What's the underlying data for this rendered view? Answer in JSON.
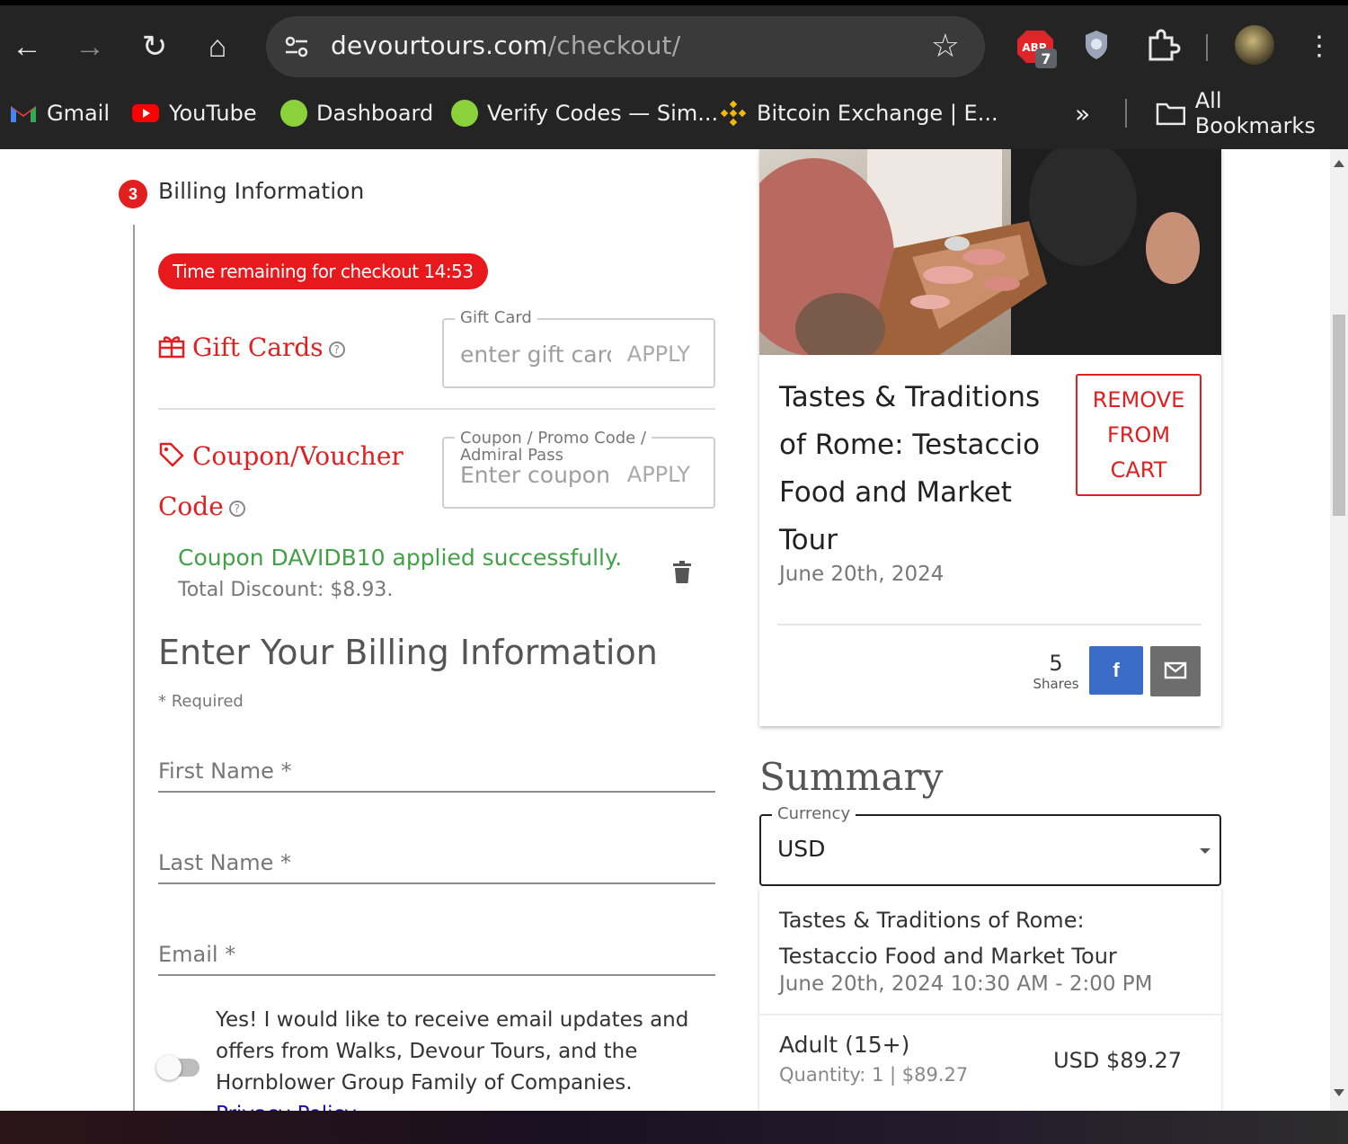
{
  "browser": {
    "url_domain": "devourtours.com",
    "url_path": "/checkout/",
    "extension_badge": "7",
    "extension_label": "ABP"
  },
  "bookmarks": [
    {
      "label": "Gmail"
    },
    {
      "label": "YouTube"
    },
    {
      "label": "Dashboard"
    },
    {
      "label": "Verify Codes — Sim..."
    },
    {
      "label": "Bitcoin Exchange | E..."
    }
  ],
  "bookmarks_overflow": "»",
  "all_bookmarks": "All Bookmarks",
  "billing": {
    "step_number": "3",
    "step_title": "Billing Information",
    "timer_text": "Time remaining for checkout 14:53",
    "gift_cards_label": "Gift Cards",
    "gift_card_legend": "Gift Card",
    "gift_card_placeholder": "enter gift card",
    "apply_label": "APPLY",
    "coupon_label_1": "Coupon/Voucher",
    "coupon_label_2": "Code",
    "coupon_legend_1": "Coupon / Promo Code /",
    "coupon_legend_2": "Admiral Pass",
    "coupon_placeholder": "Enter coupon code",
    "coupon_success": "Coupon DAVIDB10 applied successfully.",
    "total_discount": "Total Discount: $8.93.",
    "heading": "Enter Your Billing Information",
    "required_note": "* Required",
    "first_name": "First Name *",
    "last_name": "Last Name *",
    "email": "Email *",
    "optin_text": "Yes! I would like to receive email updates and offers from Walks, Devour Tours, and the Hornblower Group Family of Companies.",
    "privacy_link": "Privacy Policy",
    "optin_enabled": false
  },
  "tour_card": {
    "title": "Tastes & Traditions of Rome: Testaccio Food and Market Tour",
    "date": "June 20th, 2024",
    "remove_label_1": "REMOVE",
    "remove_label_2": "FROM",
    "remove_label_3": "CART",
    "shares_count": "5",
    "shares_label": "Shares",
    "facebook_glyph": "f"
  },
  "summary": {
    "heading": "Summary",
    "currency_legend": "Currency",
    "currency_value": "USD",
    "item_title": "Tastes & Traditions of Rome: Testaccio Food and Market Tour",
    "item_datetime": "June 20th, 2024 10:30 AM - 2:00 PM",
    "ticket_type": "Adult (15+)",
    "quantity_line": "Quantity: 1 | $89.27",
    "line_price": "USD $89.27"
  },
  "colors": {
    "accent_red": "#e02020",
    "success_green": "#43a047",
    "facebook_blue": "#3b6cc6"
  }
}
